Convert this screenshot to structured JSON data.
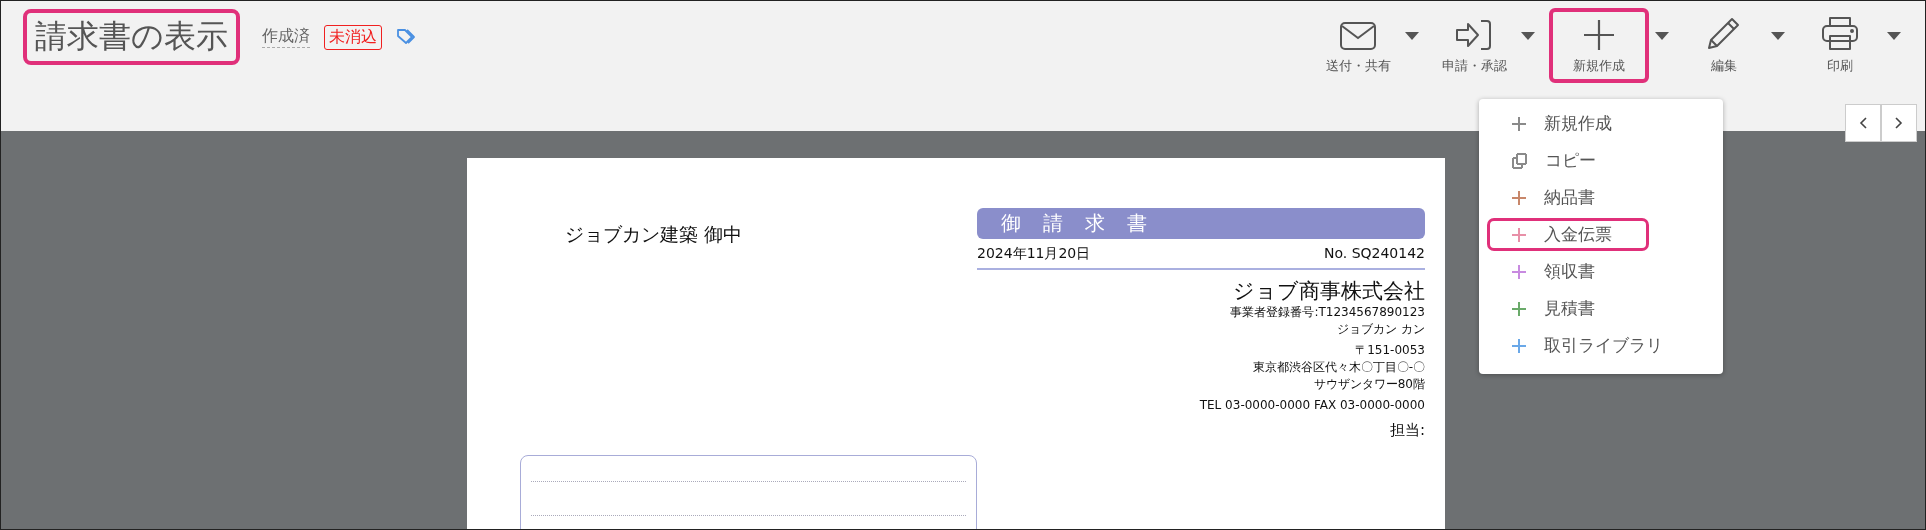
{
  "header": {
    "title": "請求書の表示",
    "title_highlighted": true,
    "status": "作成済",
    "badge": "未消込"
  },
  "toolbar": [
    {
      "label": "送付・共有",
      "kind": "mail",
      "highlighted": false
    },
    {
      "label": "申請・承認",
      "kind": "submit",
      "highlighted": false
    },
    {
      "label": "新規作成",
      "kind": "plus",
      "highlighted": true
    },
    {
      "label": "編集",
      "kind": "pencil",
      "highlighted": false
    },
    {
      "label": "印刷",
      "kind": "printer",
      "highlighted": false
    }
  ],
  "menu": [
    {
      "label": "新規作成",
      "kind": "plus",
      "color": "#8a8a8a",
      "highlighted": false
    },
    {
      "label": "コピー",
      "kind": "copy",
      "color": "#8a8a8a",
      "highlighted": false
    },
    {
      "label": "納品書",
      "kind": "plus",
      "color": "#c8876a",
      "highlighted": false
    },
    {
      "label": "入金伝票",
      "kind": "plus",
      "color": "#e890a8",
      "highlighted": true
    },
    {
      "label": "領収書",
      "kind": "plus",
      "color": "#c88ae0",
      "highlighted": false
    },
    {
      "label": "見積書",
      "kind": "plus",
      "color": "#6aaa6a",
      "highlighted": false
    },
    {
      "label": "取引ライブラリ",
      "kind": "plus",
      "color": "#6aa8e8",
      "highlighted": false
    }
  ],
  "document": {
    "recipient": "ジョブカン建築 御中",
    "title": "御請求書",
    "date": "2024年11月20日",
    "number": "No. SQ240142",
    "company": "ジョブ商事株式会社",
    "registration": "事業者登録番号:T1234567890123",
    "person": "ジョブカン カン",
    "postal": "〒151-0053",
    "address": "東京都渋谷区代々木〇丁目〇-〇",
    "building": "サウザンタワー80階",
    "phone": "TEL 03-0000-0000 FAX 03-0000-0000",
    "contact": "担当:"
  }
}
